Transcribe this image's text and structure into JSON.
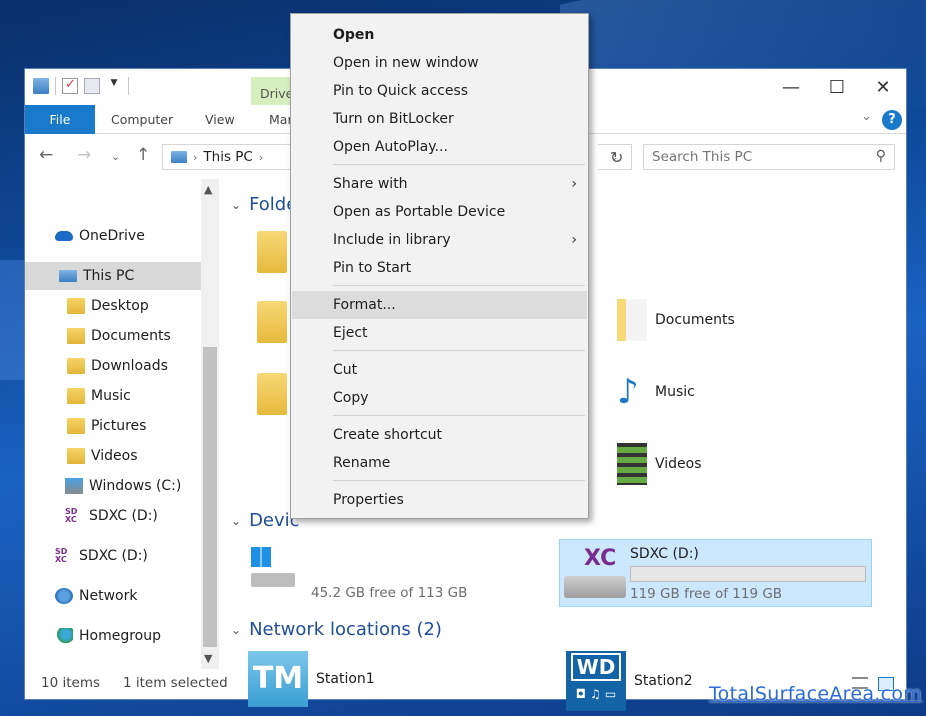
{
  "ribbon": {
    "file_tab": "File",
    "computer_tab": "Computer",
    "view_tab": "View",
    "manage_tab_partial": "Mar",
    "drive_tools_partial": "Drive"
  },
  "address": {
    "location": "This PC",
    "search_placeholder": "Search This PC"
  },
  "sidebar": {
    "items": [
      {
        "label": "OneDrive",
        "icon": "onedrive-icon"
      },
      {
        "label": "This PC",
        "icon": "this-pc-icon",
        "selected": true
      },
      {
        "label": "Desktop",
        "icon": "desktop-folder-icon"
      },
      {
        "label": "Documents",
        "icon": "documents-folder-icon"
      },
      {
        "label": "Downloads",
        "icon": "downloads-folder-icon"
      },
      {
        "label": "Music",
        "icon": "music-folder-icon"
      },
      {
        "label": "Pictures",
        "icon": "pictures-folder-icon"
      },
      {
        "label": "Videos",
        "icon": "videos-folder-icon"
      },
      {
        "label": "Windows (C:)",
        "icon": "windows-drive-icon"
      },
      {
        "label": "SDXC (D:)",
        "icon": "sdxc-icon"
      },
      {
        "label": "SDXC (D:)",
        "icon": "sdxc-icon"
      },
      {
        "label": "Network",
        "icon": "network-icon"
      },
      {
        "label": "Homegroup",
        "icon": "homegroup-icon"
      }
    ]
  },
  "main": {
    "folders_heading_partial": "Folde",
    "devices_heading_partial": "Devic",
    "network_heading": "Network locations (2)",
    "folders": [
      "Documents",
      "Music",
      "Videos"
    ],
    "c_drive_free": "45.2 GB free of 113 GB",
    "d_drive": {
      "name": "SDXC (D:)",
      "free": "119 GB free of 119 GB",
      "used_fraction": 0.0
    },
    "network_items": [
      "Station1",
      "Station2"
    ]
  },
  "status": {
    "item_count": "10 items",
    "selected": "1 item selected"
  },
  "context_menu": {
    "items": [
      {
        "label": "Open",
        "bold": true
      },
      {
        "label": "Open in new window"
      },
      {
        "label": "Pin to Quick access"
      },
      {
        "label": "Turn on BitLocker"
      },
      {
        "label": "Open AutoPlay..."
      },
      {
        "label": "Share with",
        "submenu": true
      },
      {
        "label": "Open as Portable Device"
      },
      {
        "label": "Include in library",
        "submenu": true
      },
      {
        "label": "Pin to Start"
      },
      {
        "label": "Format...",
        "highlighted": true
      },
      {
        "label": "Eject"
      },
      {
        "label": "Cut"
      },
      {
        "label": "Copy"
      },
      {
        "label": "Create shortcut"
      },
      {
        "label": "Rename"
      },
      {
        "label": "Properties"
      }
    ]
  },
  "watermark": "TotalSurfaceArea.com",
  "colors": {
    "accent": "#1979ca",
    "selection": "#cce8ff",
    "heading": "#1e4e9c"
  }
}
